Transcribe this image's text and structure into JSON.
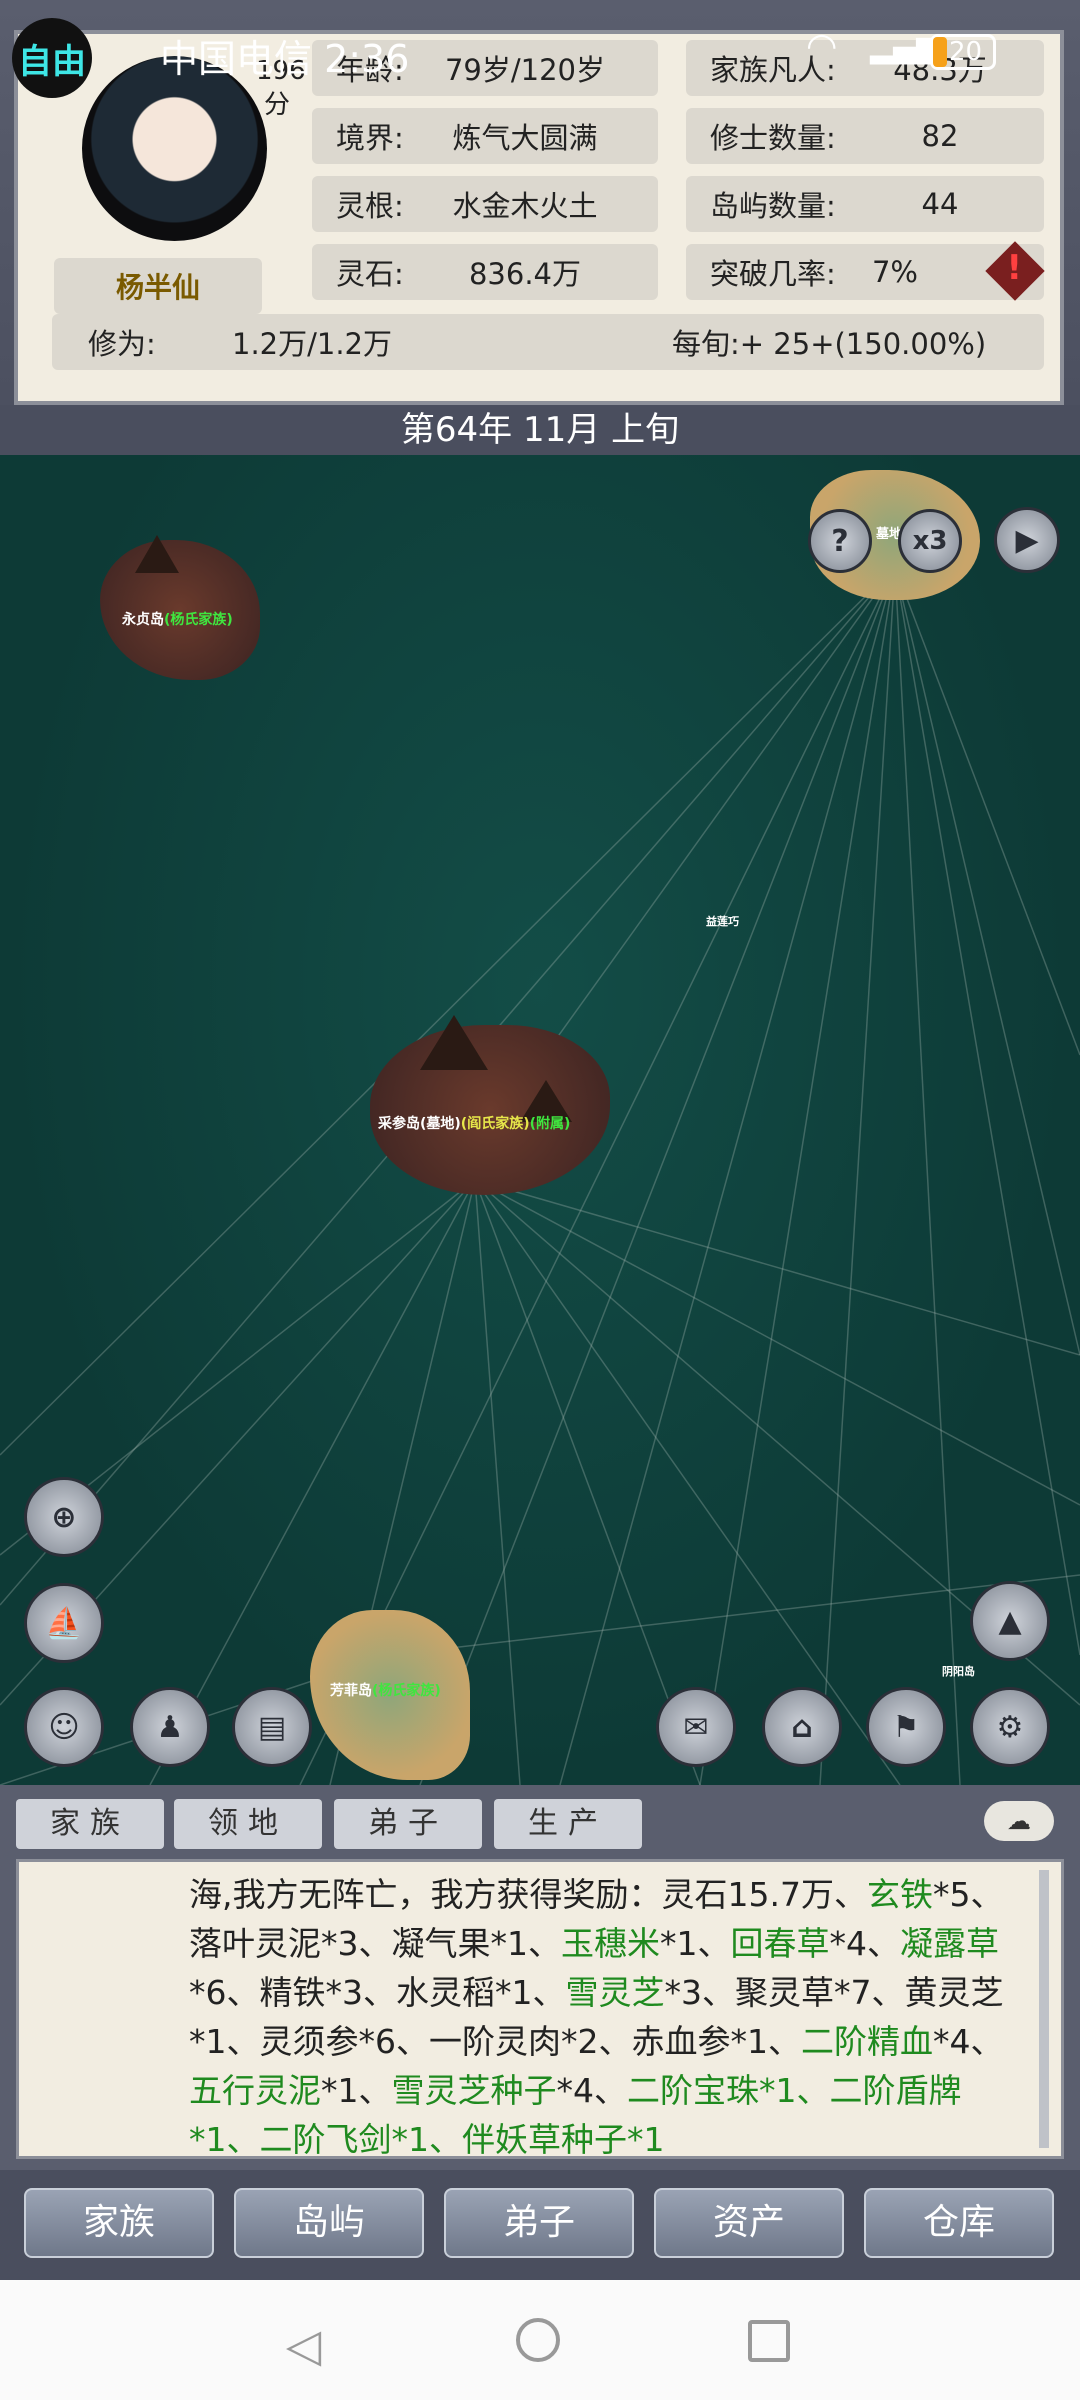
{
  "status_bar": {
    "carrier_time": "中国电信 2:36",
    "battery": "20"
  },
  "player": {
    "mode_badge": "自由",
    "name": "杨半仙",
    "score_partial": "196",
    "score_unit": "分"
  },
  "stats": [
    {
      "key": "年龄:",
      "value": "79岁/120岁"
    },
    {
      "key": "家族凡人:",
      "value": "48.3万"
    },
    {
      "key": "境界:",
      "value": "炼气大圆满"
    },
    {
      "key": "修士数量:",
      "value": "82"
    },
    {
      "key": "灵根:",
      "value": "水金木火土"
    },
    {
      "key": "岛屿数量:",
      "value": "44"
    },
    {
      "key": "灵石:",
      "value": "836.4万"
    },
    {
      "key": "突破几率:",
      "value": "7%"
    }
  ],
  "cultivation": {
    "key": "修为:",
    "value": "1.2万/1.2万",
    "rate": "每旬:+ 25+(150.00%)"
  },
  "date": "第64年 11月 上旬",
  "map": {
    "islands": [
      {
        "name": "永贞岛",
        "owner": "(杨氏家族)"
      },
      {
        "name": "采参岛(墓地)",
        "owner": "(阎氏家族)",
        "extra": "(附属)"
      },
      {
        "name": "芳菲岛",
        "owner": "(杨氏家族)"
      }
    ],
    "small_labels": [
      "墓地",
      "益莲巧",
      "阴阳岛"
    ],
    "speed": "x3",
    "help": "?"
  },
  "log_tabs": [
    "家族",
    "领地",
    "弟子",
    "生产"
  ],
  "log_segments": [
    {
      "t": "海,我方无阵亡，我方获得奖励：灵石15.7万、",
      "g": false
    },
    {
      "t": "玄铁",
      "g": true
    },
    {
      "t": "*5、落叶灵泥*3、凝气果*1、",
      "g": false
    },
    {
      "t": "玉穗米",
      "g": true
    },
    {
      "t": "*1、",
      "g": false
    },
    {
      "t": "回春草",
      "g": true
    },
    {
      "t": "*4、",
      "g": false
    },
    {
      "t": "凝露草",
      "g": true
    },
    {
      "t": "*6、精铁*3、水灵稻*1、",
      "g": false
    },
    {
      "t": "雪灵芝",
      "g": true
    },
    {
      "t": "*3、聚灵草*7、黄灵芝*1、灵须参*6、一阶灵肉*2、赤血参*1、",
      "g": false
    },
    {
      "t": "二阶精血",
      "g": true
    },
    {
      "t": "*4、",
      "g": false
    },
    {
      "t": "五行灵泥",
      "g": true
    },
    {
      "t": "*1、",
      "g": false
    },
    {
      "t": "雪灵芝种子",
      "g": true
    },
    {
      "t": "*4、",
      "g": false
    },
    {
      "t": "二阶宝珠*1、二阶盾牌*1、二阶飞剑*1、伴妖草种子*1",
      "g": true
    }
  ],
  "bottom_nav": [
    "家族",
    "岛屿",
    "弟子",
    "资产",
    "仓库"
  ]
}
